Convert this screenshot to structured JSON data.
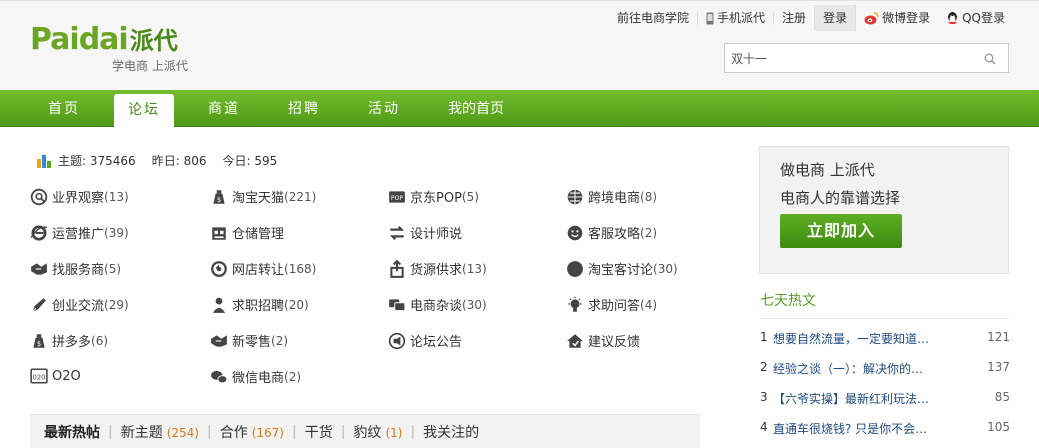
{
  "logo": {
    "brand": "Paidai",
    "brand_cn": "派代",
    "slogan": "学电商 上派代"
  },
  "toplinks": {
    "academy": "前往电商学院",
    "mobile": "手机派代",
    "register": "注册",
    "login": "登录",
    "weibo": "微博登录",
    "qq": "QQ登录"
  },
  "search": {
    "value": "双十一"
  },
  "nav": [
    "首页",
    "论坛",
    "商道",
    "招聘",
    "活动",
    "我的首页"
  ],
  "stats": {
    "topics_label": "主题:",
    "topics": "375466",
    "yesterday_label": "昨日:",
    "yesterday": "806",
    "today_label": "今日:",
    "today": "595"
  },
  "categories": [
    {
      "label": "业界观察",
      "count": "(13)",
      "icon": "search-circle-icon"
    },
    {
      "label": "淘宝天猫",
      "count": "(221)",
      "icon": "money-bag-icon"
    },
    {
      "label": "京东POP",
      "count": "(5)",
      "icon": "pop-badge-icon"
    },
    {
      "label": "跨境电商",
      "count": "(8)",
      "icon": "globe-icon"
    },
    {
      "label": "运营推广",
      "count": "(39)",
      "icon": "ie-icon"
    },
    {
      "label": "仓储管理",
      "count": "",
      "icon": "warehouse-icon"
    },
    {
      "label": "设计师说",
      "count": "",
      "icon": "transfer-icon"
    },
    {
      "label": "客服攻略",
      "count": "(2)",
      "icon": "smile-icon"
    },
    {
      "label": "找服务商",
      "count": "(5)",
      "icon": "handshake-icon"
    },
    {
      "label": "网店转让",
      "count": "(168)",
      "icon": "refresh-icon"
    },
    {
      "label": "货源供求",
      "count": "(13)",
      "icon": "upload-box-icon"
    },
    {
      "label": "淘宝客讨论",
      "count": "(30)",
      "icon": "circle-icon"
    },
    {
      "label": "创业交流",
      "count": "(29)",
      "icon": "rocket-icon"
    },
    {
      "label": "求职招聘",
      "count": "(20)",
      "icon": "person-icon"
    },
    {
      "label": "电商杂谈",
      "count": "(30)",
      "icon": "chat-icon"
    },
    {
      "label": "求助问答",
      "count": "(4)",
      "icon": "lightbulb-icon"
    },
    {
      "label": "拼多多",
      "count": "(6)",
      "icon": "money-bag-icon"
    },
    {
      "label": "新零售",
      "count": "(2)",
      "icon": "handshake-icon"
    },
    {
      "label": "论坛公告",
      "count": "",
      "icon": "announce-icon"
    },
    {
      "label": "建议反馈",
      "count": "",
      "icon": "feedback-icon"
    },
    {
      "label": "O2O",
      "count": "",
      "icon": "o2o-icon"
    },
    {
      "label": "微信电商",
      "count": "(2)",
      "icon": "wechat-icon"
    }
  ],
  "tabs": [
    {
      "label": "最新热帖",
      "count": ""
    },
    {
      "label": "新主题",
      "count": "(254)"
    },
    {
      "label": "合作",
      "count": "(167)"
    },
    {
      "label": "干货",
      "count": ""
    },
    {
      "label": "豹纹",
      "count": "(1)"
    },
    {
      "label": "我关注的",
      "count": ""
    }
  ],
  "join": {
    "line1": "做电商 上派代",
    "line2": "电商人的靠谱选择",
    "button": "立即加入"
  },
  "hot": {
    "title": "七天热文",
    "items": [
      {
        "rank": "1",
        "title": "想要自然流量，一定要知道…",
        "count": "121"
      },
      {
        "rank": "2",
        "title": "经验之谈（一）：解决你的…",
        "count": "137"
      },
      {
        "rank": "3",
        "title": "【六爷实操】最新红利玩法…",
        "count": "85"
      },
      {
        "rank": "4",
        "title": "直通车很烧钱? 只是你不会…",
        "count": "105"
      }
    ]
  },
  "colors": {
    "brand_green": "#5a9a23",
    "nav_green": "#62ab24",
    "accent_orange": "#d47a1a",
    "link_blue": "#1f4a80"
  }
}
